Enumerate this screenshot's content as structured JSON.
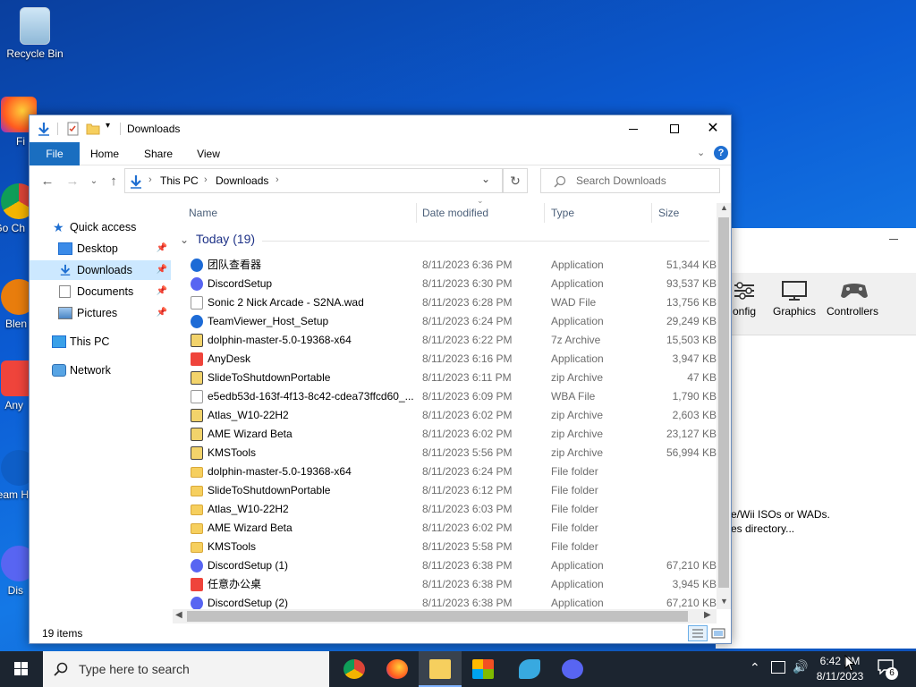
{
  "desktop": {
    "icons": [
      {
        "label": "Recycle Bin"
      },
      {
        "label": "Fi"
      },
      {
        "label": "Go Ch"
      },
      {
        "label": "Blen"
      },
      {
        "label": "Any"
      },
      {
        "label": "Team H"
      },
      {
        "label": "Dis"
      }
    ]
  },
  "dolphin": {
    "tools": [
      {
        "label": "onfig",
        "icon": "config-icon"
      },
      {
        "label": "Graphics",
        "icon": "monitor-icon"
      },
      {
        "label": "Controllers",
        "icon": "gamepad-icon"
      }
    ],
    "message_line1": "e/Wii ISOs or WADs.",
    "message_line2": "es directory..."
  },
  "explorer": {
    "title": "Downloads",
    "ribbon_tabs": [
      "File",
      "Home",
      "Share",
      "View"
    ],
    "breadcrumb": [
      "This PC",
      "Downloads"
    ],
    "search_placeholder": "Search Downloads",
    "nav": {
      "quick_access": "Quick access",
      "items": [
        {
          "label": "Desktop",
          "pinned": true
        },
        {
          "label": "Downloads",
          "pinned": true,
          "selected": true
        },
        {
          "label": "Documents",
          "pinned": true
        },
        {
          "label": "Pictures",
          "pinned": true
        }
      ],
      "this_pc": "This PC",
      "network": "Network"
    },
    "columns": {
      "name": "Name",
      "date": "Date modified",
      "type": "Type",
      "size": "Size"
    },
    "group": "Today (19)",
    "files": [
      {
        "name": "团队查看器",
        "date": "8/11/2023 6:36 PM",
        "type": "Application",
        "size": "51,344 KB",
        "icon": "teamviewer-icon",
        "color": "#1d6bd6"
      },
      {
        "name": "DiscordSetup",
        "date": "8/11/2023 6:30 PM",
        "type": "Application",
        "size": "93,537 KB",
        "icon": "discord-icon",
        "color": "#5865f2"
      },
      {
        "name": "Sonic 2 Nick Arcade - S2NA.wad",
        "date": "8/11/2023 6:28 PM",
        "type": "WAD File",
        "size": "13,756 KB",
        "icon": "file-icon",
        "color": "#ffffff"
      },
      {
        "name": "TeamViewer_Host_Setup",
        "date": "8/11/2023 6:24 PM",
        "type": "Application",
        "size": "29,249 KB",
        "icon": "teamviewer-icon",
        "color": "#1d6bd6"
      },
      {
        "name": "dolphin-master-5.0-19368-x64",
        "date": "8/11/2023 6:22 PM",
        "type": "7z Archive",
        "size": "15,503 KB",
        "icon": "zip-icon",
        "color": "#f2d36b"
      },
      {
        "name": "AnyDesk",
        "date": "8/11/2023 6:16 PM",
        "type": "Application",
        "size": "3,947 KB",
        "icon": "anydesk-icon",
        "color": "#ef443b"
      },
      {
        "name": "SlideToShutdownPortable",
        "date": "8/11/2023 6:11 PM",
        "type": "zip Archive",
        "size": "47 KB",
        "icon": "zip-icon",
        "color": "#f2d36b"
      },
      {
        "name": "e5edb53d-163f-4f13-8c42-cdea73ffcd60_...",
        "date": "8/11/2023 6:09 PM",
        "type": "WBA File",
        "size": "1,790 KB",
        "icon": "file-icon",
        "color": "#ffffff"
      },
      {
        "name": "Atlas_W10-22H2",
        "date": "8/11/2023 6:02 PM",
        "type": "zip Archive",
        "size": "2,603 KB",
        "icon": "zip-icon",
        "color": "#f2d36b"
      },
      {
        "name": "AME Wizard Beta",
        "date": "8/11/2023 6:02 PM",
        "type": "zip Archive",
        "size": "23,127 KB",
        "icon": "zip-icon",
        "color": "#f2d36b"
      },
      {
        "name": "KMSTools",
        "date": "8/11/2023 5:56 PM",
        "type": "zip Archive",
        "size": "56,994 KB",
        "icon": "zip-icon",
        "color": "#f2d36b"
      },
      {
        "name": "dolphin-master-5.0-19368-x64",
        "date": "8/11/2023 6:24 PM",
        "type": "File folder",
        "size": "",
        "icon": "folder-icon",
        "color": "#f6cf5e"
      },
      {
        "name": "SlideToShutdownPortable",
        "date": "8/11/2023 6:12 PM",
        "type": "File folder",
        "size": "",
        "icon": "folder-icon",
        "color": "#f6cf5e"
      },
      {
        "name": "Atlas_W10-22H2",
        "date": "8/11/2023 6:03 PM",
        "type": "File folder",
        "size": "",
        "icon": "folder-icon",
        "color": "#f6cf5e"
      },
      {
        "name": "AME Wizard Beta",
        "date": "8/11/2023 6:02 PM",
        "type": "File folder",
        "size": "",
        "icon": "folder-icon",
        "color": "#f6cf5e"
      },
      {
        "name": "KMSTools",
        "date": "8/11/2023 5:58 PM",
        "type": "File folder",
        "size": "",
        "icon": "folder-icon",
        "color": "#f6cf5e"
      },
      {
        "name": "DiscordSetup (1)",
        "date": "8/11/2023 6:38 PM",
        "type": "Application",
        "size": "67,210 KB",
        "icon": "discord-icon",
        "color": "#5865f2"
      },
      {
        "name": "任意办公桌",
        "date": "8/11/2023 6:38 PM",
        "type": "Application",
        "size": "3,945 KB",
        "icon": "anydesk-icon",
        "color": "#ef443b"
      },
      {
        "name": "DiscordSetup (2)",
        "date": "8/11/2023 6:38 PM",
        "type": "Application",
        "size": "67,210 KB",
        "icon": "discord-icon",
        "color": "#5865f2"
      }
    ],
    "status": "19 items"
  },
  "taskbar": {
    "search_placeholder": "Type here to search",
    "apps": [
      {
        "name": "chrome-icon",
        "color": "#e8453c"
      },
      {
        "name": "firefox-icon",
        "color": "#ff7a1a"
      },
      {
        "name": "file-explorer-icon",
        "color": "#f6cf5e",
        "active": true
      },
      {
        "name": "store-icon",
        "color": "#3b8be8"
      },
      {
        "name": "dolphin-icon",
        "color": "#38a9e0"
      },
      {
        "name": "discord-icon",
        "color": "#5865f2"
      }
    ],
    "time": "6:42 PM",
    "date": "8/11/2023",
    "notifications": "6"
  }
}
